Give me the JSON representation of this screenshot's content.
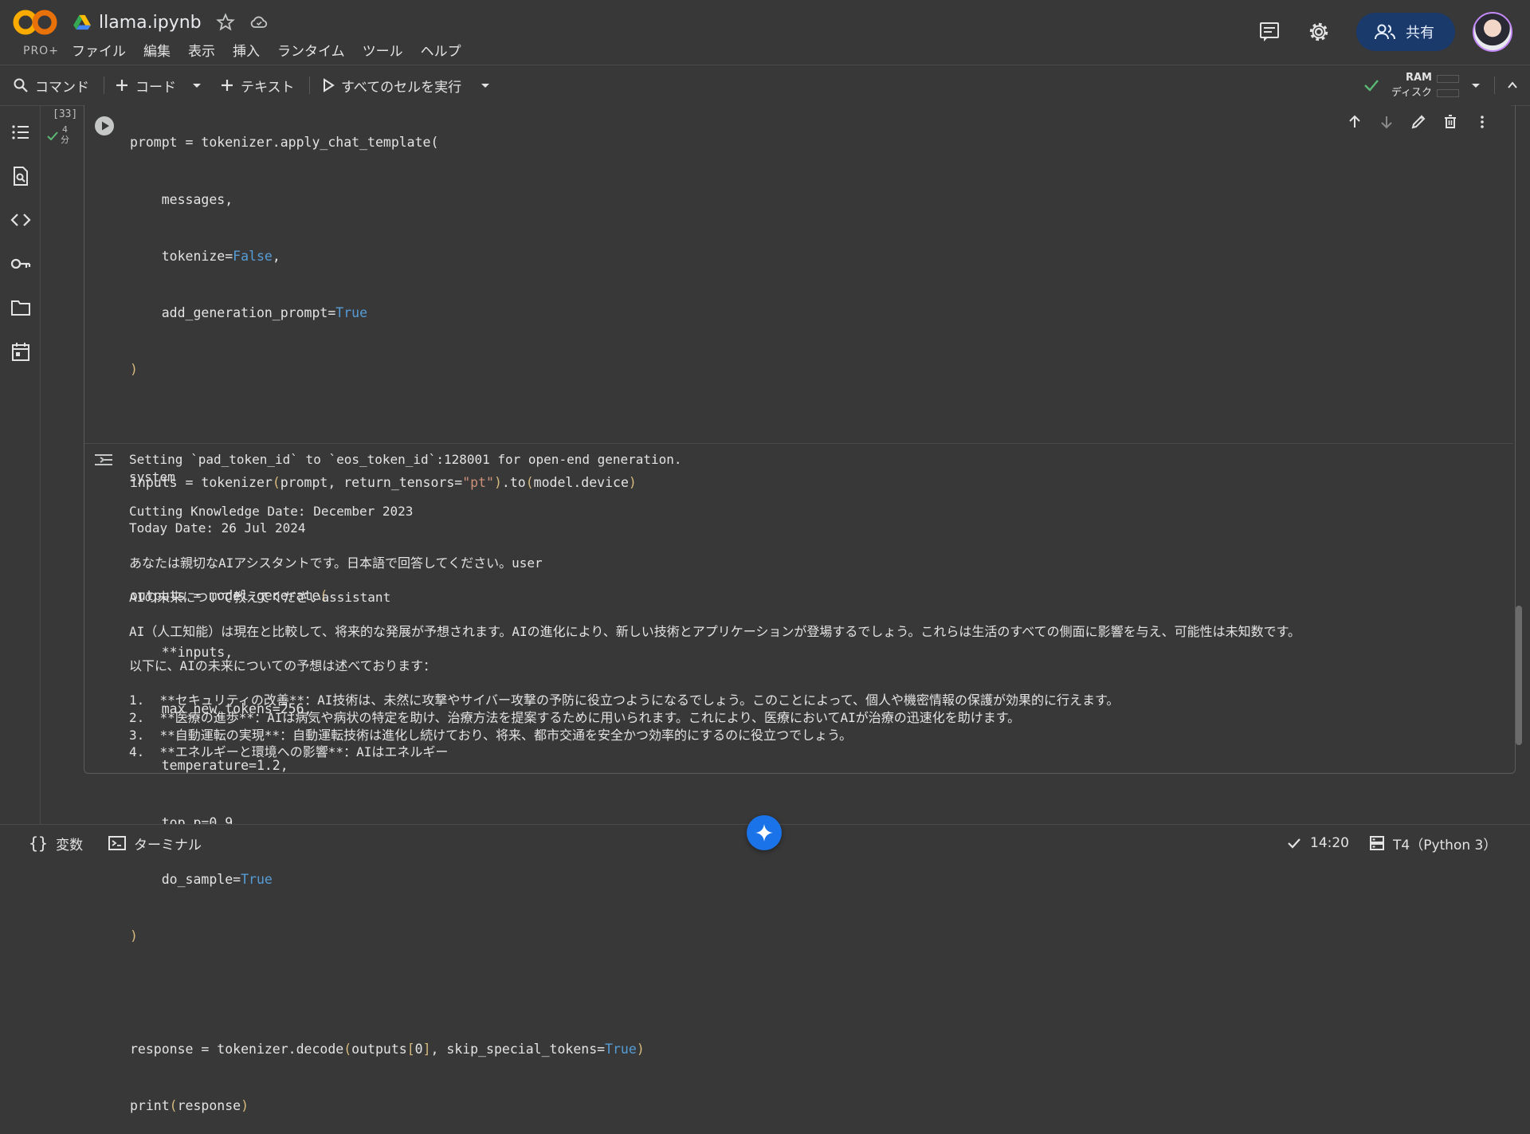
{
  "header": {
    "logo_text": "CO",
    "plan": "PRO+",
    "title": "llama.ipynb",
    "menu": [
      "ファイル",
      "編集",
      "表示",
      "挿入",
      "ランタイム",
      "ツール",
      "ヘルプ"
    ],
    "share_label": "共有"
  },
  "toolbar": {
    "command": "コマンド",
    "code": "コード",
    "text": "テキスト",
    "run_all": "すべてのセルを実行",
    "ram": "RAM",
    "disk": "ディスク"
  },
  "cell": {
    "exec_count": "[33]",
    "exec_time_value": "4",
    "exec_time_unit": "分",
    "code_lines": [
      "prompt = tokenizer.apply_chat_template(",
      "    messages,",
      "    tokenize=False,",
      "    add_generation_prompt=True",
      ")",
      "",
      "inputs = tokenizer(prompt, return_tensors=\"pt\").to(model.device)",
      "",
      "outputs = model.generate(",
      "    **inputs,",
      "    max_new_tokens=256,",
      "    temperature=1.2,",
      "    top_p=0.9,",
      "    do_sample=True",
      ")",
      "",
      "response = tokenizer.decode(outputs[0], skip_special_tokens=True)",
      "print(response)"
    ],
    "output_lines": [
      "Setting `pad_token_id` to `eos_token_id`:128001 for open-end generation.",
      "system",
      "",
      "Cutting Knowledge Date: December 2023",
      "Today Date: 26 Jul 2024",
      "",
      "あなたは親切なAIアシスタントです。日本語で回答してください。user",
      "",
      "AIの未来について教えてくださいassistant",
      "",
      "AI（人工知能）は現在と比較して、将来的な発展が予想されます。AIの進化により、新しい技術とアプリケーションが登場するでしょう。これらは生活のすべての側面に影響を与え、可能性は未知数です。",
      "",
      "以下に、AIの未来についての予想は述べております：",
      "",
      "1.  **セキュリティの改善**：AI技術は、未然に攻撃やサイバー攻撃の予防に役立つようになるでしょう。このことによって、個人や機密情報の保護が効果的に行えます。",
      "2.  **医療の進歩**：AIは病気や病状の特定を助け、治療方法を提案するために用いられます。これにより、医療においてAIが治療の迅速化を助けます。",
      "3.  **自動運転の実現**：自動運転技術は進化し続けており、将来、都市交通を安全かつ効率的にするのに役立つでしょう。",
      "4.  **エネルギーと環境への影響**：AIはエネルギー"
    ]
  },
  "statusbar": {
    "variables": "変数",
    "terminal": "ターミナル",
    "time": "14:20",
    "runtime": "T4（Python 3）"
  },
  "colors": {
    "background": "#383838",
    "accent_blue": "#1a73e8",
    "share_bg": "#1a3a6b",
    "check_green": "#5bb974",
    "keyword_blue": "#569cd6"
  },
  "icons": {
    "header": [
      "drive-icon",
      "star-icon",
      "cloud-icon",
      "comment-icon",
      "gear-icon",
      "people-icon",
      "avatar"
    ],
    "toolbar": [
      "search-icon",
      "plus-icon",
      "chevron-down-icon",
      "play-icon",
      "check-icon",
      "chevron-up-icon"
    ],
    "sidebar": [
      "toc-icon",
      "find-icon",
      "code-icon",
      "key-icon",
      "folder-icon",
      "calendar-icon"
    ],
    "cell": [
      "play-circle-icon",
      "arrow-up-icon",
      "arrow-down-icon",
      "edit-icon",
      "trash-icon",
      "more-vert-icon",
      "output-icon"
    ],
    "statusbar": [
      "braces-icon",
      "terminal-icon",
      "check-icon",
      "server-icon",
      "sparkle-icon"
    ]
  }
}
